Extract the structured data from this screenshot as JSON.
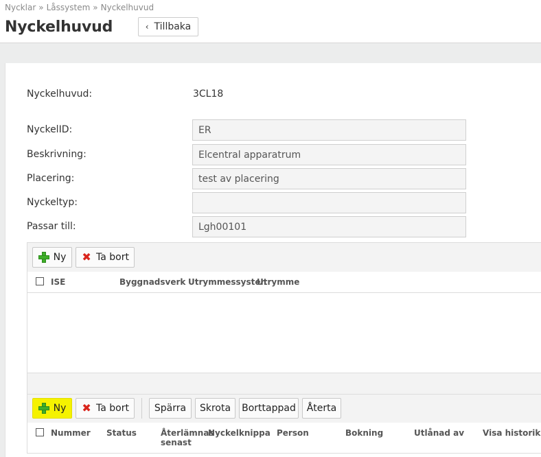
{
  "breadcrumb": [
    "Nycklar",
    "Låssystem",
    "Nyckelhuvud"
  ],
  "breadcrumb_separator": "»",
  "page_title": "Nyckelhuvud",
  "back_button": {
    "label": "Tillbaka",
    "icon": "chevron-left-icon"
  },
  "form": {
    "header_label": "Nyckelhuvud:",
    "header_value": "3CL18",
    "fields": [
      {
        "label": "NyckelID:",
        "value": "ER"
      },
      {
        "label": "Beskrivning:",
        "value": "Elcentral apparatrum"
      },
      {
        "label": "Placering:",
        "value": "test av placering"
      },
      {
        "label": "Nyckeltyp:",
        "value": ""
      },
      {
        "label": "Passar till:",
        "value": "Lgh00101"
      }
    ]
  },
  "ise_grid": {
    "toolbar": {
      "new_label": "Ny",
      "delete_label": "Ta bort"
    },
    "columns": [
      "ISE",
      "Byggnadsverk",
      "Utrymmessysten",
      "Utrymme"
    ],
    "rows": []
  },
  "keys_grid": {
    "toolbar": {
      "new_label": "Ny",
      "delete_label": "Ta bort",
      "block_label": "Spärra",
      "scrap_label": "Skrota",
      "lost_label": "Borttappad",
      "restore_label": "Återta"
    },
    "columns": [
      "Nummer",
      "Status",
      "Återlämnas senast",
      "Nyckelknippa",
      "Person",
      "Bokning",
      "Utlånad av",
      "Visa historik"
    ]
  },
  "colors": {
    "highlight": "#f5f200",
    "plus_green": "#3fae29",
    "delete_red": "#d9241b"
  }
}
